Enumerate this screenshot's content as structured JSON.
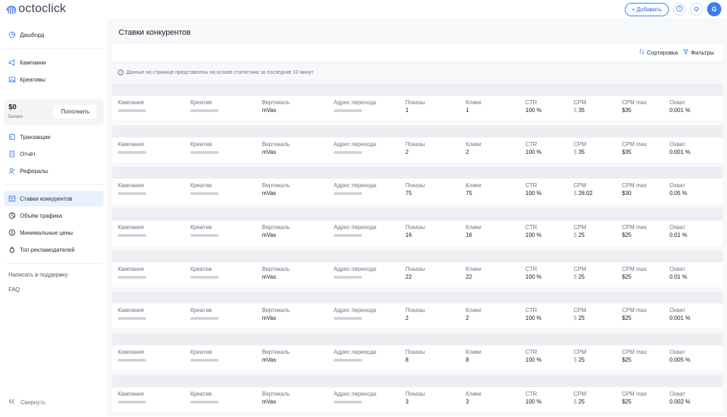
{
  "app": {
    "logo_text": "octoclick"
  },
  "header": {
    "add_label": "+ Добавить",
    "help_icon": "question-icon",
    "bell_icon": "bell-icon",
    "avatar_letter": "G"
  },
  "sidebar": {
    "items": [
      {
        "label": "Дашборд",
        "icon": "dashboard-icon"
      },
      {
        "label": "Кампании",
        "icon": "megaphone-icon"
      },
      {
        "label": "Креативы",
        "icon": "image-icon"
      },
      {
        "label": "Транзакции",
        "icon": "transactions-icon"
      },
      {
        "label": "Отчёт",
        "icon": "report-icon"
      },
      {
        "label": "Рефералы",
        "icon": "referrals-icon"
      },
      {
        "label": "Ставки конкурентов",
        "icon": "table-icon",
        "active": true
      },
      {
        "label": "Объём трафика",
        "icon": "pie-icon"
      },
      {
        "label": "Минимальные цены",
        "icon": "dollar-icon"
      },
      {
        "label": "Топ рекламодателей",
        "icon": "medal-icon"
      }
    ],
    "balance": {
      "amount": "$0",
      "label": "Баланс",
      "topup_label": "Пополнить"
    },
    "support_label": "Написать в поддержку",
    "faq_label": "FAQ",
    "collapse_label": "Свернуть"
  },
  "main": {
    "title": "Ставки конкурентов",
    "sort_label": "Сортировка",
    "filters_label": "Фильтры",
    "info_text": "Данные на странице представлены на основе статистики за последние 10 минут"
  },
  "columns": {
    "campaign": "Кампания",
    "creative": "Креатив",
    "vertical": "Вертикаль",
    "url": "Адрес перехода",
    "impressions": "Показы",
    "clicks": "Клики",
    "ctr": "CTR",
    "cpm": "CPM",
    "cpm_max": "CPM max",
    "reach": "Охват"
  },
  "rows": [
    {
      "vertical": "mVas",
      "impressions": "1",
      "clicks": "1",
      "ctr": "100 %",
      "cpm_currency": "$",
      "cpm": "35",
      "cpm_max": "$35",
      "reach": "0.001 %"
    },
    {
      "vertical": "mVas",
      "impressions": "2",
      "clicks": "2",
      "ctr": "100 %",
      "cpm_currency": "$",
      "cpm": "35",
      "cpm_max": "$35",
      "reach": "0.001 %"
    },
    {
      "vertical": "mVas",
      "impressions": "75",
      "clicks": "75",
      "ctr": "100 %",
      "cpm_currency": "$",
      "cpm": "26.02",
      "cpm_max": "$30",
      "reach": "0.05 %"
    },
    {
      "vertical": "mVas",
      "impressions": "16",
      "clicks": "16",
      "ctr": "100 %",
      "cpm_currency": "$",
      "cpm": "25",
      "cpm_max": "$25",
      "reach": "0.01 %"
    },
    {
      "vertical": "mVas",
      "impressions": "22",
      "clicks": "22",
      "ctr": "100 %",
      "cpm_currency": "$",
      "cpm": "25",
      "cpm_max": "$25",
      "reach": "0.01 %"
    },
    {
      "vertical": "mVas",
      "impressions": "2",
      "clicks": "2",
      "ctr": "100 %",
      "cpm_currency": "$",
      "cpm": "25",
      "cpm_max": "$25",
      "reach": "0.001 %"
    },
    {
      "vertical": "mVas",
      "impressions": "8",
      "clicks": "8",
      "ctr": "100 %",
      "cpm_currency": "$",
      "cpm": "25",
      "cpm_max": "$25",
      "reach": "0.005 %"
    },
    {
      "vertical": "mVas",
      "impressions": "3",
      "clicks": "3",
      "ctr": "100 %",
      "cpm_currency": "$",
      "cpm": "25",
      "cpm_max": "$25",
      "reach": "0.002 %"
    }
  ],
  "colors": {
    "accent": "#3b7bf6",
    "active_bg": "#e8f0fe",
    "page_bg": "#f7f8fa"
  }
}
